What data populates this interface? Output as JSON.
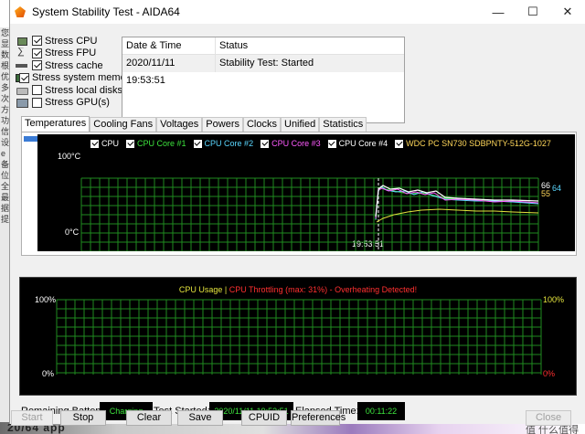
{
  "window": {
    "title": "System Stability Test - AIDA64"
  },
  "title_buttons": {
    "minimize": "—",
    "maximize": "☐",
    "close": "✕"
  },
  "checks": [
    {
      "label": "Stress CPU",
      "checked": true,
      "icon": "cpu-icon"
    },
    {
      "label": "Stress FPU",
      "checked": true,
      "icon": "fpu-icon"
    },
    {
      "label": "Stress cache",
      "checked": true,
      "icon": "cache-icon"
    },
    {
      "label": "Stress system memo",
      "checked": true,
      "icon": "memory-icon"
    },
    {
      "label": "Stress local disks",
      "checked": false,
      "icon": "disk-icon"
    },
    {
      "label": "Stress GPU(s)",
      "checked": false,
      "icon": "gpu-icon"
    }
  ],
  "status_table": {
    "headers": [
      "Date & Time",
      "Status"
    ],
    "rows": [
      [
        "2020/11/11 19:53:51",
        "Stability Test: Started"
      ]
    ]
  },
  "tabs": [
    "Temperatures",
    "Cooling Fans",
    "Voltages",
    "Powers",
    "Clocks",
    "Unified",
    "Statistics"
  ],
  "temp_graph": {
    "legend": [
      {
        "label": "CPU",
        "color": "#ffffff"
      },
      {
        "label": "CPU Core #1",
        "color": "#3de33d"
      },
      {
        "label": "CPU Core #2",
        "color": "#5ad7ff"
      },
      {
        "label": "CPU Core #3",
        "color": "#ff5aff"
      },
      {
        "label": "CPU Core #4",
        "color": "#ffffff"
      },
      {
        "label": "WDC PC SN730 SDBPNTY-512G-1027",
        "color": "#ffd75a"
      }
    ],
    "y_top": "100°C",
    "y_bottom": "0°C",
    "time_label": "19:53:51",
    "val_a": "66",
    "val_b": "64",
    "val_c": "55"
  },
  "chart_data": {
    "type": "line",
    "title": "",
    "ylabel": "",
    "xlabel": "",
    "ylim": [
      0,
      100
    ],
    "x_marker": "19:53:51",
    "series": [
      {
        "name": "CPU",
        "current": 66
      },
      {
        "name": "CPU Core #1",
        "current": 64
      },
      {
        "name": "CPU Core #2",
        "current": 64
      },
      {
        "name": "CPU Core #3",
        "current": 64
      },
      {
        "name": "CPU Core #4",
        "current": 64
      },
      {
        "name": "WDC PC SN730 SDBPNTY-512G-1027",
        "current": 55
      }
    ]
  },
  "usage_graph": {
    "legend_a": "CPU Usage",
    "legend_sep": " | ",
    "legend_b": "CPU Throttling (max: 31%) - Overheating Detected!",
    "y_top_left": "100%",
    "y_bottom_left": "0%",
    "y_top_right": "100%",
    "y_bottom_right": "0%"
  },
  "info": {
    "battery_label": "Remaining Battery:",
    "battery_value": "Charging",
    "started_label": "Test Started:",
    "started_value": "2020/11/11 19:53:51",
    "elapsed_label": "Elapsed Time:",
    "elapsed_value": "00:11:22"
  },
  "buttons": {
    "start": "Start",
    "stop": "Stop",
    "clear": "Clear",
    "save": "Save",
    "cpuid": "CPUID",
    "preferences": "Preferences",
    "close": "Close"
  },
  "background": {
    "left_glyphs": [
      "您",
      "显",
      "数",
      "根",
      "优",
      "多",
      "次",
      "方",
      "功",
      "信",
      "设",
      "e",
      "备",
      "位",
      "全",
      "最",
      "据",
      "提"
    ],
    "bottom_text": "20/64 app",
    "bottom_right": "值 什么值得买"
  },
  "colors": {
    "green": "#3de33d",
    "yellow": "#e3e33d",
    "red": "#ff3030",
    "grid": "#1f8a1f"
  }
}
